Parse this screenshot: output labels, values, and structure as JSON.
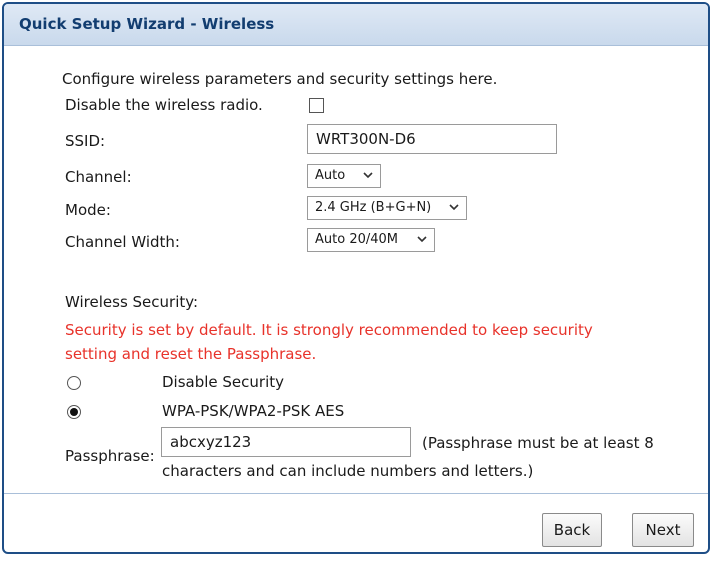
{
  "window": {
    "title": "Quick Setup Wizard - Wireless"
  },
  "intro": {
    "text": "Configure wireless parameters and security settings here."
  },
  "wireless": {
    "disable_radio_label": "Disable the wireless radio.",
    "disable_radio_checked": false,
    "ssid_label": "SSID:",
    "ssid_value": "WRT300N-D6",
    "channel_label": "Channel:",
    "channel_value": "Auto",
    "mode_label": "Mode:",
    "mode_value": "2.4 GHz (B+G+N)",
    "width_label": "Channel Width:",
    "width_value": "Auto 20/40M"
  },
  "security": {
    "heading": "Wireless Security:",
    "warning_line1": "Security is set by default. It is strongly recommended to keep security",
    "warning_line2": "setting and reset the Passphrase.",
    "warning_color": "#e8322a",
    "options": [
      {
        "label": "Disable Security",
        "checked": false
      },
      {
        "label": "WPA-PSK/WPA2-PSK AES",
        "checked": true
      }
    ],
    "passphrase_label": "Passphrase:",
    "passphrase_value": "abcxyz123",
    "hint_line1": "(Passphrase must be at least 8",
    "hint_line2": "characters and can include numbers and letters.)"
  },
  "footer": {
    "back_label": "Back",
    "next_label": "Next"
  },
  "colors": {
    "border": "#1e4e86",
    "title_text": "#123d70"
  }
}
